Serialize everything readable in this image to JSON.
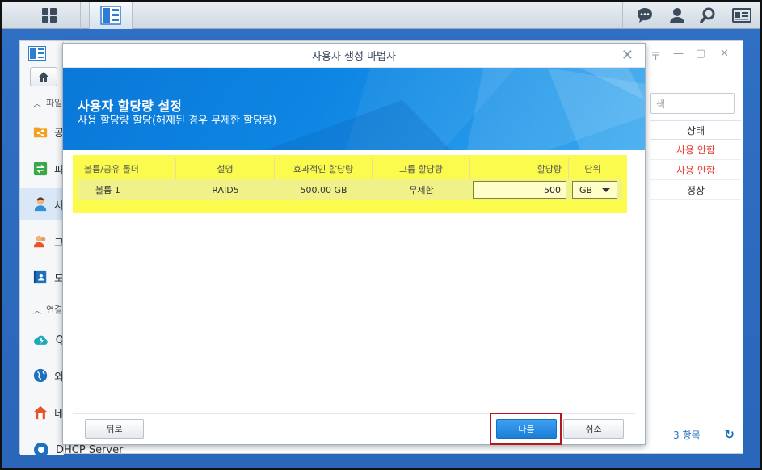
{
  "app": {
    "sidebar": {
      "sections": [
        {
          "label": "파일"
        },
        {
          "label": "연결"
        }
      ],
      "items": [
        {
          "label": "공",
          "icon": "share-folder-icon"
        },
        {
          "label": "파",
          "icon": "file-services-icon"
        },
        {
          "label": "사",
          "icon": "user-icon"
        },
        {
          "label": "그",
          "icon": "group-icon"
        },
        {
          "label": "도",
          "icon": "domain-icon"
        },
        {
          "label": "Q",
          "icon": "quickconnect-icon"
        },
        {
          "label": "외",
          "icon": "external-access-icon"
        },
        {
          "label": "네",
          "icon": "network-icon"
        }
      ],
      "bottom_item": "DHCP Server"
    },
    "search_placeholder": "색",
    "status_header": "상태",
    "status_rows": [
      {
        "value": "사용 안함",
        "color": "#e03a2f"
      },
      {
        "value": "사용 안함",
        "color": "#e03a2f"
      },
      {
        "value": "정상",
        "color": "#333333"
      }
    ],
    "footer_count": "3 항목"
  },
  "dialog": {
    "title": "사용자 생성 마법사",
    "banner_title": "사용자 할당량 설정",
    "banner_subtitle": "사용 할당량 할당(해제된 경우 무제한 할당량)",
    "table": {
      "headers": [
        "볼륨/공유 폴더",
        "설명",
        "효과적인 할당량",
        "그룹 할당량",
        "할당량",
        "단위"
      ],
      "row": {
        "volume": "볼륨 1",
        "description": "RAID5",
        "effective_quota": "500.00 GB",
        "group_quota": "무제한",
        "quota": "500",
        "unit": "GB"
      }
    },
    "buttons": {
      "back": "뒤로",
      "next": "다음",
      "cancel": "취소"
    }
  },
  "colors": {
    "highlight_yellow": "#fbfb4e",
    "primary_blue": "#1b7fd8",
    "annotation_red": "#b3181d"
  }
}
